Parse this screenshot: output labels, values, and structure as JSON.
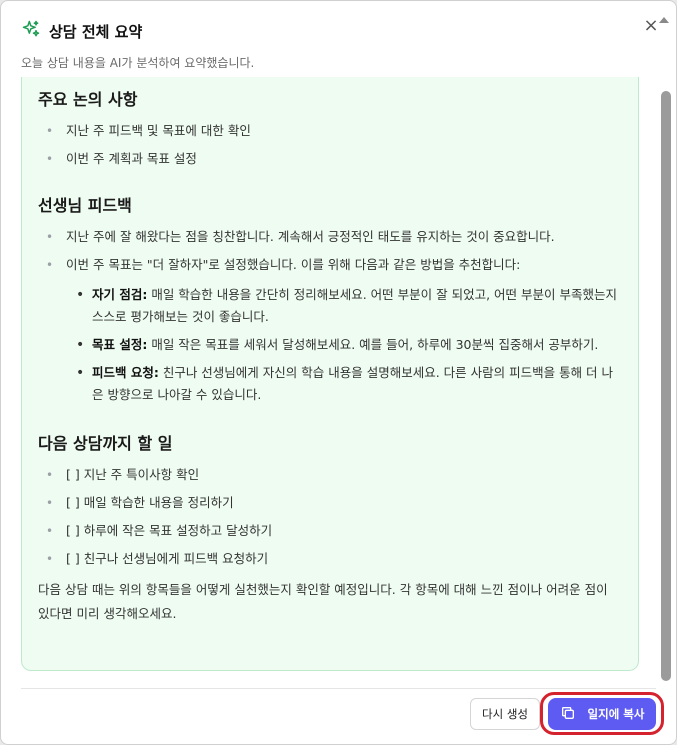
{
  "header": {
    "title": "상담 전체 요약",
    "subtitle": "오늘 상담 내용을 AI가 분석하여 요약했습니다.",
    "close_glyph": "×"
  },
  "summary": {
    "section1": {
      "heading": "주요 논의 사항",
      "items": [
        "지난 주 피드백 및 목표에 대한 확인",
        "이번 주 계획과 목표 설정"
      ]
    },
    "section2": {
      "heading": "선생님 피드백",
      "items": [
        "지난 주에 잘 해왔다는 점을 칭찬합니다. 계속해서 긍정적인 태도를 유지하는 것이 중요합니다.",
        "이번 주 목표는 \"더 잘하자\"로 설정했습니다. 이를 위해 다음과 같은 방법을 추천합니다:"
      ],
      "sub_items": [
        {
          "label": "자기 점검:",
          "text": " 매일 학습한 내용을 간단히 정리해보세요. 어떤 부분이 잘 되었고, 어떤 부분이 부족했는지 스스로 평가해보는 것이 좋습니다."
        },
        {
          "label": "목표 설정:",
          "text": " 매일 작은 목표를 세워서 달성해보세요. 예를 들어, 하루에 30분씩 집중해서 공부하기."
        },
        {
          "label": "피드백 요청:",
          "text": " 친구나 선생님에게 자신의 학습 내용을 설명해보세요. 다른 사람의 피드백을 통해 더 나은 방향으로 나아갈 수 있습니다."
        }
      ]
    },
    "section3": {
      "heading": "다음 상담까지 할 일",
      "items": [
        "[ ] 지난 주 특이사항 확인",
        "[ ] 매일 학습한 내용을 정리하기",
        "[ ] 하루에 작은 목표 설정하고 달성하기",
        "[ ] 친구나 선생님에게 피드백 요청하기"
      ]
    },
    "closing": "다음 상담 때는 위의 항목들을 어떻게 실천했는지 확인할 예정입니다. 각 항목에 대해 느낀 점이나 어려운 점이 있다면 미리 생각해오세요."
  },
  "footer": {
    "regenerate_label": "다시 생성",
    "copy_label": "일지에 복사"
  },
  "colors": {
    "accent": "#5e5bf2",
    "summary_bg": "#effcf2",
    "highlight_ring": "#d4232f",
    "sparkle": "#1f9d55"
  },
  "icons": [
    "sparkle-icon",
    "close-icon",
    "copy-icon"
  ]
}
